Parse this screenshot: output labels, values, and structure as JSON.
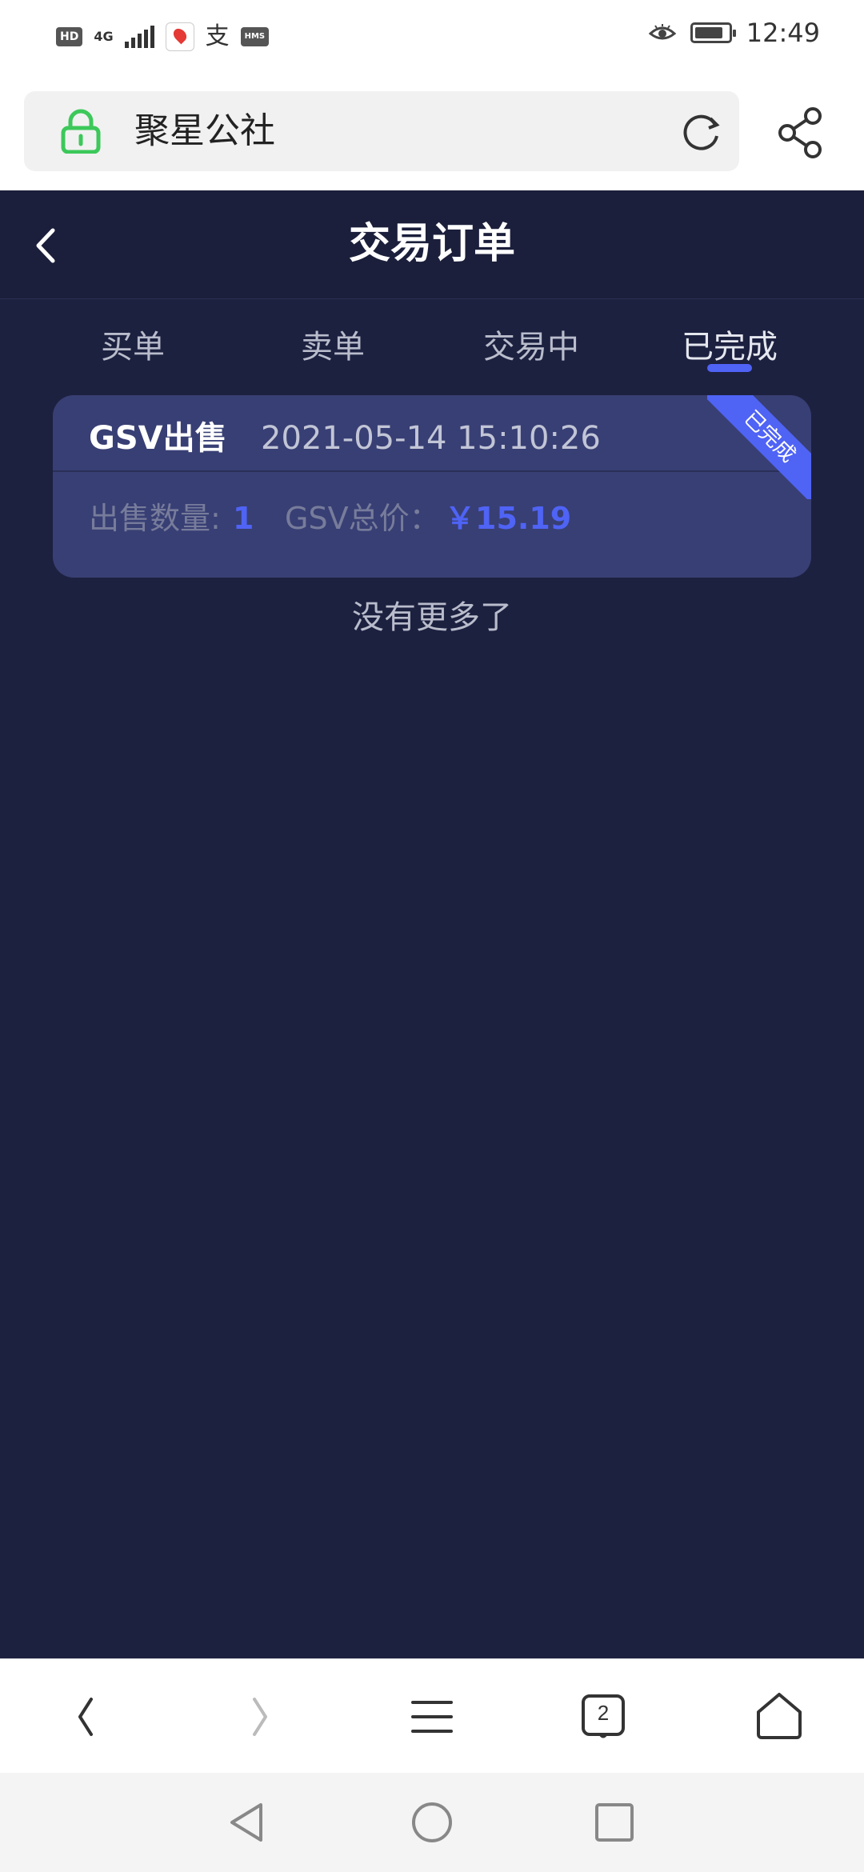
{
  "status_bar": {
    "hd_badge": "HD",
    "network": "4G",
    "hms_badge": "HMS",
    "alipay_glyph": "支",
    "time": "12:49",
    "battery_level": 0.85
  },
  "browser": {
    "url_title": "聚星公社",
    "tab_count": "2"
  },
  "header": {
    "title": "交易订单"
  },
  "tabs": [
    {
      "label": "买单"
    },
    {
      "label": "卖单"
    },
    {
      "label": "交易中"
    },
    {
      "label": "已完成"
    }
  ],
  "active_tab": 3,
  "order": {
    "title": "GSV出售",
    "time": "2021-05-14 15:10:26",
    "quantity_label": "出售数量:",
    "quantity_value": "1",
    "total_label": "GSV总价：",
    "total_value": "￥15.19",
    "status_ribbon": "已完成"
  },
  "list_end_text": "没有更多了",
  "colors": {
    "page_bg": "#1d2140",
    "accent": "#4f63f5",
    "card_bg": "#383f74",
    "lock_green": "#3cc85a"
  }
}
